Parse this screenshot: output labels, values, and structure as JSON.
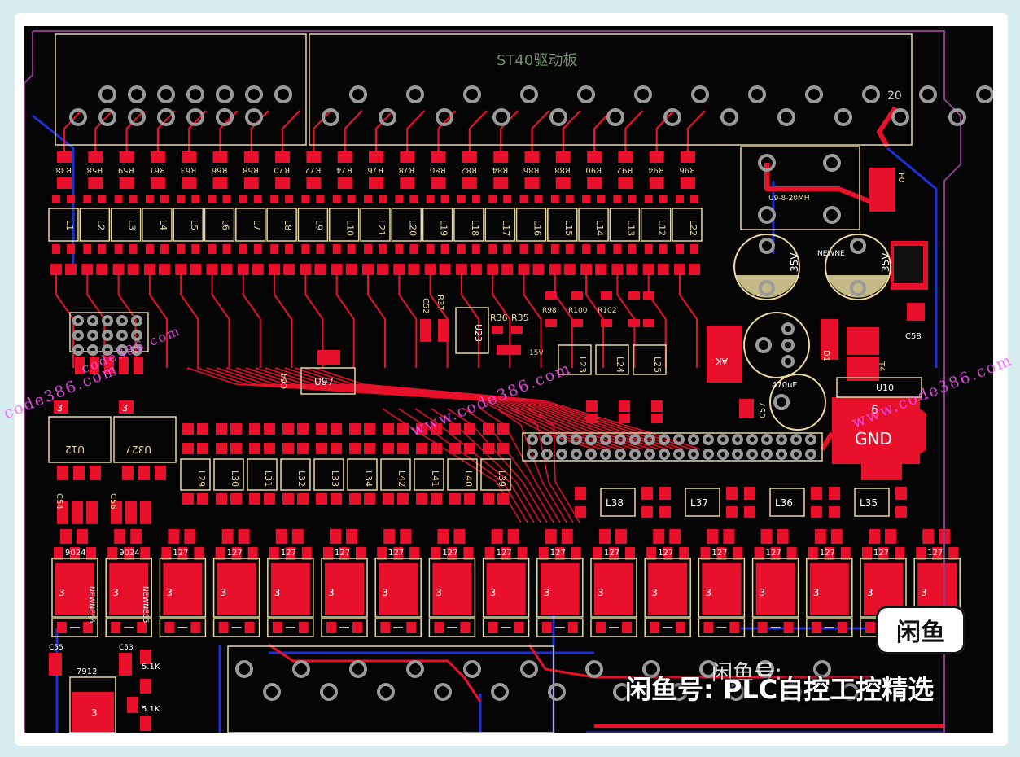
{
  "board": {
    "title": "ST40驱动板",
    "connector_pin": "20",
    "top_resistors": [
      "R38",
      "R58",
      "R59",
      "R61",
      "R63",
      "R66",
      "R68",
      "R70",
      "R72",
      "R74",
      "R76",
      "R78",
      "R80",
      "R82",
      "R84",
      "R86",
      "R88",
      "R90",
      "R92",
      "R94",
      "R96"
    ],
    "top_inductors": [
      "L1",
      "L2",
      "L3",
      "L4",
      "L5",
      "L6",
      "L7",
      "L8",
      "L9",
      "L10",
      "L21",
      "L20",
      "L19",
      "L18",
      "L17",
      "L16",
      "L15",
      "L14",
      "L13",
      "L12",
      "L22"
    ],
    "mid_inductors": [
      "L29",
      "L30",
      "L31",
      "L32",
      "L33",
      "L34",
      "L42",
      "L41",
      "L40",
      "L39"
    ],
    "right_inductors": [
      "L38",
      "L37",
      "L36",
      "L35"
    ],
    "small_inductors": [
      "L23",
      "L24",
      "L25"
    ],
    "bottom_regs": [
      "9024",
      "9024",
      "127",
      "127",
      "127",
      "127",
      "127",
      "127",
      "127",
      "127",
      "127",
      "127",
      "127",
      "127",
      "127",
      "127",
      "127"
    ],
    "reg_pad": "3",
    "ic_u12": "U12",
    "ic_u327": "U327",
    "ic_u97": "U97",
    "ic_u23": "U23",
    "ic_u10": "U10",
    "gnd": "GND",
    "gnd_num": "6",
    "transformer": "U9-8-20MH",
    "cap_35v": "35V",
    "cap_470": "470uF",
    "zener": "15V",
    "labels": {
      "c52": "C52",
      "r37": "R37",
      "r36": "R36",
      "r35": "R35",
      "r98": "R98",
      "r100": "R100",
      "r102": "R102",
      "c64": "C64",
      "c54": "C54",
      "c56": "C56",
      "c55": "C55",
      "c53": "C53",
      "c57": "C57",
      "c58": "C58",
      "d1": "D1",
      "ak": "AK",
      "t4": "T4",
      "f0": "F0",
      "r7912": "7912",
      "r51k_a": "5.1K",
      "r51k_b": "5.1K",
      "newne": "NEWNE",
      "newne55": "NEWNE55",
      "newne56": "NEWNE56",
      "newne_b": "NEWNE"
    },
    "pad3": "3"
  },
  "watermarks": [
    "code386.com",
    "www.code386.com",
    "code386.com",
    "www.code386.com"
  ],
  "badge": {
    "text": "闲鱼"
  },
  "caption": {
    "main": "闲鱼号: PLC自控工控精选",
    "ghost": "闲鱼号:"
  },
  "colors": {
    "board": "#050505",
    "copper": "#e8102a",
    "silk": "#e8d9a0",
    "pad": "#9a9a9a",
    "blue": "#1f2fd8"
  }
}
